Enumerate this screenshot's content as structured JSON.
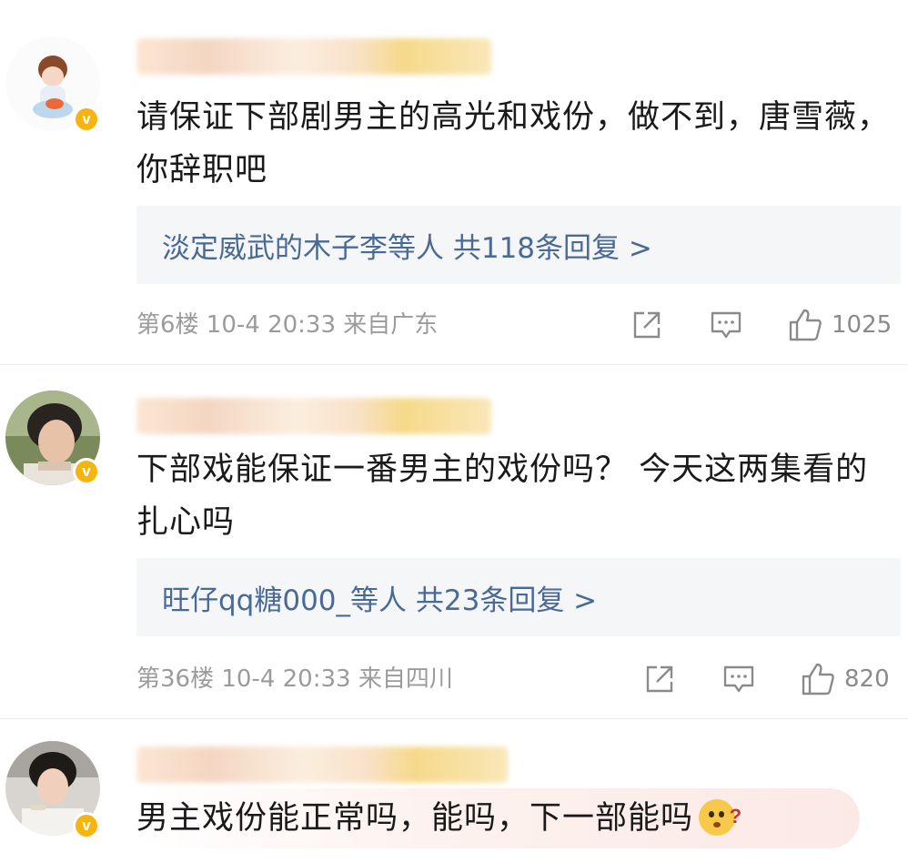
{
  "comments": [
    {
      "text": "请保证下部剧男主的高光和戏份，做不到，唐雪薇，你辞职吧",
      "replies": "淡定威武的木子李等人  共118条回复 >",
      "meta": "第6楼  10-4  20:33  来自广东",
      "likes": "1025",
      "verified_badge": "v"
    },
    {
      "text": "下部戏能保证一番男主的戏份吗？ 今天这两集看的扎心吗",
      "replies": "旺仔qq糖000_等人  共23条回复 >",
      "meta": "第36楼  10-4  20:33  来自四川",
      "likes": "820",
      "verified_badge": "v"
    },
    {
      "text": "男主戏份能正常吗，能吗，下一部能吗",
      "verified_badge": "v",
      "emoji": "confused-emoji"
    }
  ],
  "icons": {
    "share": "share-icon",
    "comment": "comment-icon",
    "like": "thumbs-up-icon"
  },
  "colors": {
    "reply_link": "#4a6a96",
    "meta": "#9b9b9b",
    "badge": "#f6b40e"
  }
}
